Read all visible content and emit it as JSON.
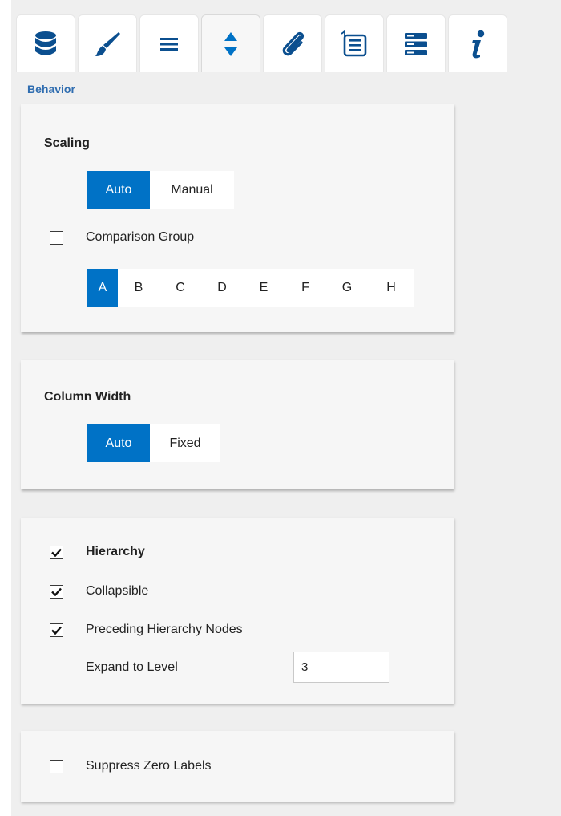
{
  "tabs": [
    {
      "icon": "database-icon"
    },
    {
      "icon": "paintbrush-icon"
    },
    {
      "icon": "hamburger-menu-icon"
    },
    {
      "icon": "sort-arrows-icon",
      "active": true
    },
    {
      "icon": "paperclip-icon"
    },
    {
      "icon": "numbered-list-icon"
    },
    {
      "icon": "server-stack-icon"
    },
    {
      "icon": "info-icon"
    }
  ],
  "section_label": "Behavior",
  "accent_color": "#0072c6",
  "scaling": {
    "title": "Scaling",
    "modes": [
      "Auto",
      "Manual"
    ],
    "selected_mode": "Auto",
    "comparison_group": {
      "label": "Comparison Group",
      "checked": false
    },
    "groups": [
      "A",
      "B",
      "C",
      "D",
      "E",
      "F",
      "G",
      "H"
    ],
    "selected_group": "A"
  },
  "column_width": {
    "title": "Column Width",
    "modes": [
      "Auto",
      "Fixed"
    ],
    "selected_mode": "Auto"
  },
  "hierarchy": {
    "hierarchy": {
      "label": "Hierarchy",
      "checked": true
    },
    "collapsible": {
      "label": "Collapsible",
      "checked": true
    },
    "preceding_nodes": {
      "label": "Preceding Hierarchy Nodes",
      "checked": true
    },
    "expand_to_level": {
      "label": "Expand to Level",
      "value": "3"
    }
  },
  "zero_labels": {
    "label": "Suppress Zero Labels",
    "checked": false
  }
}
